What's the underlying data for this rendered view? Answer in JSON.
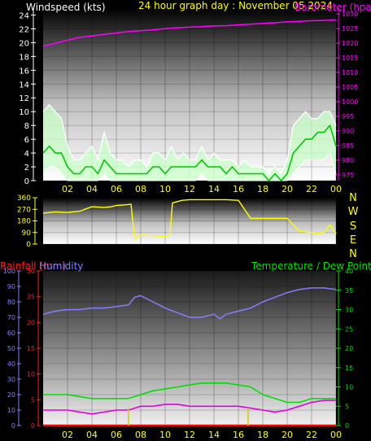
{
  "page": {
    "title": "24 hour graph day : November 05 2024"
  },
  "colors": {
    "background": "#000000",
    "time_axis": "#ffff00",
    "wind_speed": "#ffffff",
    "wind_avg": "#00c800",
    "wind_fill": "#c8ffc8",
    "barometer": "#ff00ff",
    "direction": "#ffff00",
    "rainfall": "#ff0000",
    "rain_bars": "#d4c800",
    "humidity": "#8080ff",
    "temperature": "#00e000",
    "dew_point": "#e000e0"
  },
  "chart_data": [
    {
      "id": "wind-baro",
      "type": "line",
      "title": "24 hour graph day : November 05 2024",
      "x_ticks": [
        "02",
        "04",
        "06",
        "08",
        "10",
        "12",
        "14",
        "16",
        "18",
        "20",
        "22",
        "00"
      ],
      "left_axis": {
        "label": "Windspeed (kts)",
        "range": [
          0,
          25
        ],
        "ticks": [
          "0",
          "2",
          "4",
          "6",
          "8",
          "10",
          "12",
          "14",
          "16",
          "18",
          "20",
          "22",
          "24"
        ]
      },
      "right_axis": {
        "label": "Barometer (hpa)",
        "range": [
          973,
          1032
        ],
        "ticks": [
          "975",
          "980",
          "985",
          "990",
          "995",
          "1000",
          "1005",
          "1010",
          "1015",
          "1020",
          "1025",
          "1030"
        ]
      },
      "grid": true,
      "series": [
        {
          "name": "Windspeed (kts)",
          "axis": "left",
          "x": [
            0,
            0.5,
            1,
            1.5,
            2,
            2.5,
            3,
            3.5,
            4,
            4.5,
            5,
            5.5,
            6,
            6.5,
            7,
            7.5,
            8,
            8.5,
            9,
            9.5,
            10,
            10.5,
            11,
            11.5,
            12,
            12.5,
            13,
            13.5,
            14,
            14.5,
            15,
            15.5,
            16,
            16.5,
            17,
            17.5,
            18,
            18.5,
            19,
            19.5,
            20,
            20.5,
            21,
            21.5,
            22,
            22.5,
            23,
            23.5,
            24
          ],
          "gust": [
            10,
            11,
            10,
            9,
            5,
            3,
            3,
            4,
            5,
            3,
            7,
            4,
            3,
            3,
            2,
            3,
            3,
            2,
            4,
            4,
            3,
            5,
            3,
            4,
            3,
            3,
            5,
            3,
            4,
            3,
            3,
            3,
            2,
            3,
            2,
            2,
            2,
            1,
            2,
            1,
            3,
            8,
            9,
            10,
            9,
            9,
            10,
            10,
            8
          ],
          "avg": [
            4,
            5,
            4,
            4,
            2,
            1,
            1,
            2,
            2,
            1,
            3,
            2,
            1,
            1,
            1,
            1,
            1,
            1,
            2,
            2,
            1,
            2,
            2,
            2,
            2,
            2,
            3,
            2,
            2,
            2,
            1,
            2,
            1,
            1,
            1,
            1,
            1,
            0,
            1,
            0,
            1,
            4,
            5,
            6,
            6,
            7,
            7,
            8,
            5
          ],
          "low": [
            1,
            2,
            2,
            1,
            0,
            0,
            0,
            0,
            0,
            0,
            1,
            0,
            0,
            0,
            0,
            0,
            0,
            0,
            0,
            0,
            0,
            0,
            0,
            0,
            0,
            0,
            1,
            0,
            0,
            0,
            0,
            0,
            0,
            0,
            0,
            0,
            0,
            0,
            0,
            0,
            0,
            1,
            2,
            3,
            3,
            3,
            3,
            4,
            1
          ]
        },
        {
          "name": "Barometer (hpa)",
          "axis": "right",
          "x": [
            0,
            1,
            2,
            3,
            4,
            5,
            6,
            7,
            8,
            9,
            10,
            11,
            12,
            13,
            14,
            15,
            16,
            17,
            18,
            19,
            20,
            21,
            22,
            23,
            24
          ],
          "values": [
            1019,
            1020,
            1021,
            1022,
            1022.5,
            1023,
            1023.5,
            1024,
            1024.3,
            1024.6,
            1025,
            1025.3,
            1025.5,
            1025.7,
            1025.9,
            1026,
            1026.3,
            1026.5,
            1026.8,
            1027,
            1027.3,
            1027.5,
            1027.7,
            1027.8,
            1028
          ]
        }
      ]
    },
    {
      "id": "direction",
      "type": "line",
      "x_ticks": [],
      "left_axis": {
        "label": "",
        "range": [
          0,
          360
        ],
        "ticks": [
          "0",
          "90",
          "180",
          "270",
          "360"
        ]
      },
      "compass": [
        "N",
        "W",
        "S",
        "E",
        "N"
      ],
      "grid": true,
      "series": [
        {
          "name": "Wind direction",
          "axis": "left",
          "x": [
            0,
            1,
            2,
            3,
            3.4,
            4,
            5,
            5.6,
            6,
            6.8,
            7.2,
            7.5,
            7.8,
            8,
            9,
            10,
            10.4,
            10.6,
            11,
            11.4,
            12,
            13,
            14,
            15,
            16,
            17,
            18,
            19,
            19.5,
            20,
            21,
            22,
            22.5,
            23,
            23.5,
            24
          ],
          "values": [
            240,
            250,
            245,
            255,
            270,
            290,
            285,
            290,
            300,
            305,
            310,
            40,
            60,
            70,
            65,
            60,
            70,
            320,
            330,
            340,
            345,
            345,
            345,
            345,
            340,
            200,
            200,
            200,
            200,
            200,
            100,
            90,
            85,
            90,
            150,
            80
          ]
        }
      ]
    },
    {
      "id": "rain-hum-temp",
      "type": "line",
      "x_ticks": [
        "02",
        "04",
        "06",
        "08",
        "10",
        "12",
        "14",
        "16",
        "18",
        "20",
        "22",
        "00"
      ],
      "rain_axis": {
        "label": "Rainfall (mm)",
        "range": [
          0,
          30
        ],
        "ticks": [
          "0",
          "5",
          "10",
          "15",
          "20",
          "25",
          "30"
        ]
      },
      "humidity_axis": {
        "label": "Humidity",
        "range": [
          0,
          100
        ],
        "ticks": [
          "0",
          "10",
          "20",
          "30",
          "40",
          "50",
          "60",
          "70",
          "80",
          "90",
          "100"
        ]
      },
      "temp_axis": {
        "label": "Temperature / Dew Point (°C)",
        "range": [
          0,
          40
        ],
        "ticks": [
          "0",
          "5",
          "10",
          "15",
          "20",
          "25",
          "30",
          "35",
          "40"
        ]
      },
      "legend": {
        "left": [
          "Rainfall (mm)",
          "Humidity"
        ],
        "right": [
          "Temperature / Dew Point (°C)"
        ]
      },
      "grid": true,
      "series": [
        {
          "name": "Humidity",
          "axis": "humidity",
          "x": [
            0,
            1,
            2,
            3,
            4,
            5,
            6,
            7,
            7.5,
            8,
            9,
            10,
            11,
            12,
            13,
            14,
            14.5,
            15,
            16,
            17,
            18,
            19,
            20,
            21,
            22,
            23,
            24
          ],
          "values": [
            72,
            74,
            75,
            75,
            76,
            76,
            77,
            78,
            83,
            84,
            80,
            76,
            73,
            70,
            70,
            72,
            69,
            72,
            74,
            76,
            80,
            83,
            86,
            88,
            89,
            89,
            88
          ]
        },
        {
          "name": "Temperature",
          "axis": "temp",
          "x": [
            0,
            1,
            2,
            3,
            4,
            5,
            6,
            7,
            8,
            9,
            10,
            11,
            12,
            13,
            14,
            15,
            16,
            17,
            18,
            19,
            20,
            21,
            22,
            23,
            24
          ],
          "values": [
            8,
            8,
            8,
            7.5,
            7,
            7,
            7,
            7,
            8,
            9,
            9.5,
            10,
            10.5,
            11,
            11,
            11,
            10.5,
            10,
            8,
            7,
            6,
            6,
            7,
            7,
            7
          ]
        },
        {
          "name": "Dew Point",
          "axis": "temp",
          "x": [
            0,
            1,
            2,
            3,
            4,
            5,
            6,
            7,
            8,
            9,
            10,
            11,
            12,
            13,
            14,
            15,
            16,
            17,
            18,
            19,
            20,
            21,
            22,
            23,
            24
          ],
          "values": [
            4,
            4,
            4,
            3.5,
            3,
            3.5,
            4,
            4,
            5,
            5,
            5.5,
            5.5,
            5,
            5,
            5,
            5,
            5,
            4.5,
            4,
            3.5,
            4,
            5,
            6,
            6.5,
            6.5
          ]
        },
        {
          "name": "Rainfall (mm)",
          "axis": "rain",
          "x": [
            0,
            24
          ],
          "values": [
            0,
            0
          ]
        },
        {
          "name": "Rain events",
          "axis": "rain",
          "type": "bar",
          "x": [
            7,
            16.8
          ],
          "values": [
            1.5,
            1.5
          ]
        }
      ]
    }
  ]
}
